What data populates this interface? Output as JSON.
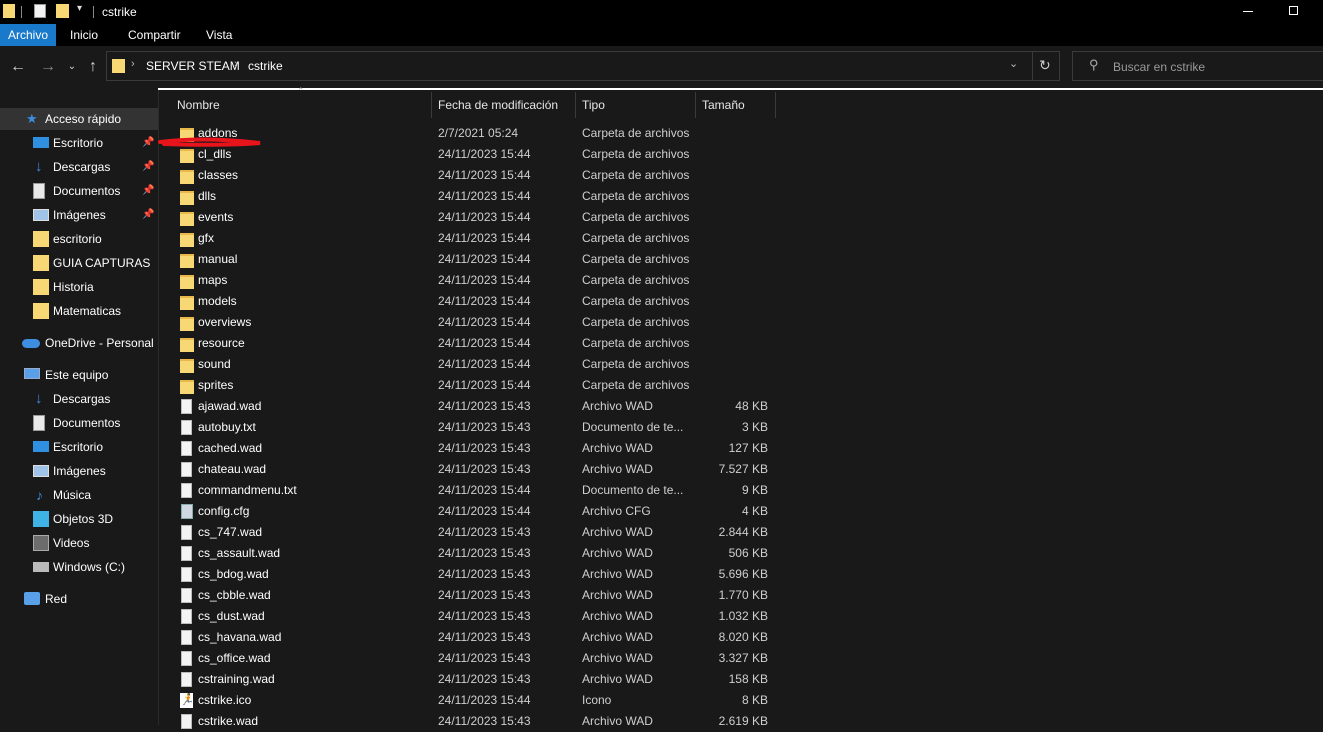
{
  "window": {
    "title": "cstrike"
  },
  "ribbon": {
    "tabs": [
      "Archivo",
      "Inicio",
      "Compartir",
      "Vista"
    ]
  },
  "address": {
    "segments": [
      "SERVER STEAM",
      "cstrike"
    ]
  },
  "search": {
    "placeholder": "Buscar en cstrike"
  },
  "nav": {
    "quick_access": "Acceso rápido",
    "quick_items": [
      {
        "label": "Escritorio",
        "icon": "desktop-icon",
        "pinned": true
      },
      {
        "label": "Descargas",
        "icon": "download-icon",
        "pinned": true
      },
      {
        "label": "Documentos",
        "icon": "documents-icon",
        "pinned": true
      },
      {
        "label": "Imágenes",
        "icon": "pictures-icon",
        "pinned": true
      },
      {
        "label": "escritorio",
        "icon": "folder-icon",
        "pinned": false
      },
      {
        "label": "GUIA CAPTURAS",
        "icon": "folder-icon",
        "pinned": false
      },
      {
        "label": "Historia",
        "icon": "folder-icon",
        "pinned": false
      },
      {
        "label": "Matematicas",
        "icon": "folder-icon",
        "pinned": false
      }
    ],
    "onedrive": "OneDrive - Personal",
    "this_pc": "Este equipo",
    "pc_items": [
      {
        "label": "Descargas",
        "icon": "download-icon"
      },
      {
        "label": "Documentos",
        "icon": "documents-icon"
      },
      {
        "label": "Escritorio",
        "icon": "desktop-icon"
      },
      {
        "label": "Imágenes",
        "icon": "pictures-icon"
      },
      {
        "label": "Música",
        "icon": "music-icon"
      },
      {
        "label": "Objetos 3D",
        "icon": "3d-objects-icon"
      },
      {
        "label": "Videos",
        "icon": "videos-icon"
      },
      {
        "label": "Windows (C:)",
        "icon": "drive-icon"
      }
    ],
    "network": "Red"
  },
  "columns": {
    "name": "Nombre",
    "date": "Fecha de modificación",
    "type": "Tipo",
    "size": "Tamaño"
  },
  "files": [
    {
      "name": "addons",
      "date": "2/7/2021 05:24",
      "type": "Carpeta de archivos",
      "size": "",
      "kind": "folder"
    },
    {
      "name": "cl_dlls",
      "date": "24/11/2023 15:44",
      "type": "Carpeta de archivos",
      "size": "",
      "kind": "folder"
    },
    {
      "name": "classes",
      "date": "24/11/2023 15:44",
      "type": "Carpeta de archivos",
      "size": "",
      "kind": "folder"
    },
    {
      "name": "dlls",
      "date": "24/11/2023 15:44",
      "type": "Carpeta de archivos",
      "size": "",
      "kind": "folder"
    },
    {
      "name": "events",
      "date": "24/11/2023 15:44",
      "type": "Carpeta de archivos",
      "size": "",
      "kind": "folder"
    },
    {
      "name": "gfx",
      "date": "24/11/2023 15:44",
      "type": "Carpeta de archivos",
      "size": "",
      "kind": "folder"
    },
    {
      "name": "manual",
      "date": "24/11/2023 15:44",
      "type": "Carpeta de archivos",
      "size": "",
      "kind": "folder"
    },
    {
      "name": "maps",
      "date": "24/11/2023 15:44",
      "type": "Carpeta de archivos",
      "size": "",
      "kind": "folder"
    },
    {
      "name": "models",
      "date": "24/11/2023 15:44",
      "type": "Carpeta de archivos",
      "size": "",
      "kind": "folder"
    },
    {
      "name": "overviews",
      "date": "24/11/2023 15:44",
      "type": "Carpeta de archivos",
      "size": "",
      "kind": "folder"
    },
    {
      "name": "resource",
      "date": "24/11/2023 15:44",
      "type": "Carpeta de archivos",
      "size": "",
      "kind": "folder"
    },
    {
      "name": "sound",
      "date": "24/11/2023 15:44",
      "type": "Carpeta de archivos",
      "size": "",
      "kind": "folder"
    },
    {
      "name": "sprites",
      "date": "24/11/2023 15:44",
      "type": "Carpeta de archivos",
      "size": "",
      "kind": "folder"
    },
    {
      "name": "ajawad.wad",
      "date": "24/11/2023 15:43",
      "type": "Archivo WAD",
      "size": "48 KB",
      "kind": "file"
    },
    {
      "name": "autobuy.txt",
      "date": "24/11/2023 15:43",
      "type": "Documento de te...",
      "size": "3 KB",
      "kind": "txt"
    },
    {
      "name": "cached.wad",
      "date": "24/11/2023 15:43",
      "type": "Archivo WAD",
      "size": "127 KB",
      "kind": "file"
    },
    {
      "name": "chateau.wad",
      "date": "24/11/2023 15:43",
      "type": "Archivo WAD",
      "size": "7.527 KB",
      "kind": "file"
    },
    {
      "name": "commandmenu.txt",
      "date": "24/11/2023 15:44",
      "type": "Documento de te...",
      "size": "9 KB",
      "kind": "txt"
    },
    {
      "name": "config.cfg",
      "date": "24/11/2023 15:44",
      "type": "Archivo CFG",
      "size": "4 KB",
      "kind": "cfg"
    },
    {
      "name": "cs_747.wad",
      "date": "24/11/2023 15:43",
      "type": "Archivo WAD",
      "size": "2.844 KB",
      "kind": "file"
    },
    {
      "name": "cs_assault.wad",
      "date": "24/11/2023 15:43",
      "type": "Archivo WAD",
      "size": "506 KB",
      "kind": "file"
    },
    {
      "name": "cs_bdog.wad",
      "date": "24/11/2023 15:43",
      "type": "Archivo WAD",
      "size": "5.696 KB",
      "kind": "file"
    },
    {
      "name": "cs_cbble.wad",
      "date": "24/11/2023 15:43",
      "type": "Archivo WAD",
      "size": "1.770 KB",
      "kind": "file"
    },
    {
      "name": "cs_dust.wad",
      "date": "24/11/2023 15:43",
      "type": "Archivo WAD",
      "size": "1.032 KB",
      "kind": "file"
    },
    {
      "name": "cs_havana.wad",
      "date": "24/11/2023 15:43",
      "type": "Archivo WAD",
      "size": "8.020 KB",
      "kind": "file"
    },
    {
      "name": "cs_office.wad",
      "date": "24/11/2023 15:43",
      "type": "Archivo WAD",
      "size": "3.327 KB",
      "kind": "file"
    },
    {
      "name": "cstraining.wad",
      "date": "24/11/2023 15:43",
      "type": "Archivo WAD",
      "size": "158 KB",
      "kind": "file"
    },
    {
      "name": "cstrike.ico",
      "date": "24/11/2023 15:44",
      "type": "Icono",
      "size": "8 KB",
      "kind": "ico"
    },
    {
      "name": "cstrike.wad",
      "date": "24/11/2023 15:43",
      "type": "Archivo WAD",
      "size": "2.619 KB",
      "kind": "file"
    }
  ],
  "colors": {
    "accent": "#1979ca",
    "folder": "#f8d775",
    "annotation": "#e8141b",
    "background": "#191919"
  }
}
